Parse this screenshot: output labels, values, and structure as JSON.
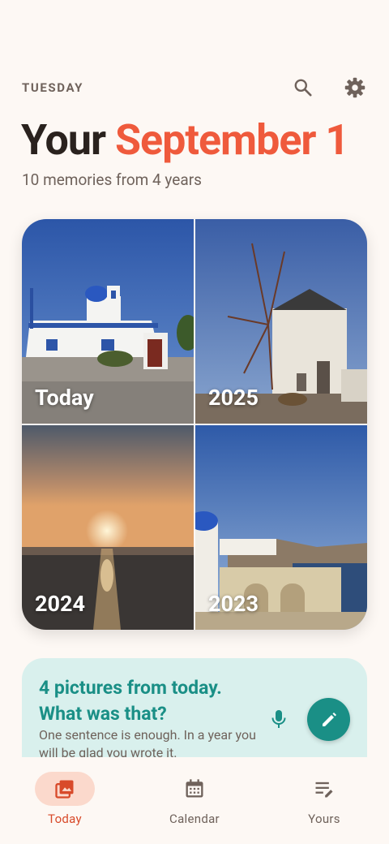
{
  "header": {
    "day": "TUESDAY",
    "icons": [
      "search-icon",
      "gear-icon"
    ]
  },
  "title": {
    "prefix": "Your",
    "date": "September 1"
  },
  "subtitle": "10 memories from 4 years",
  "memories": [
    {
      "label": "Today"
    },
    {
      "label": "2025"
    },
    {
      "label": "2024"
    },
    {
      "label": "2023"
    }
  ],
  "prompt": {
    "title": "4 pictures from today. What was that?",
    "body": "One sentence is enough. In a year you will be glad you wrote it."
  },
  "nav": {
    "items": [
      {
        "label": "Today",
        "icon": "photo-album-icon",
        "active": true
      },
      {
        "label": "Calendar",
        "icon": "calendar-icon",
        "active": false
      },
      {
        "label": "Yours",
        "icon": "notes-edit-icon",
        "active": false
      }
    ]
  },
  "colors": {
    "accent": "#ef5a3c",
    "teal": "#1a8f86",
    "background": "#fdf8f4",
    "prompt_bg": "#d9f0ed"
  }
}
